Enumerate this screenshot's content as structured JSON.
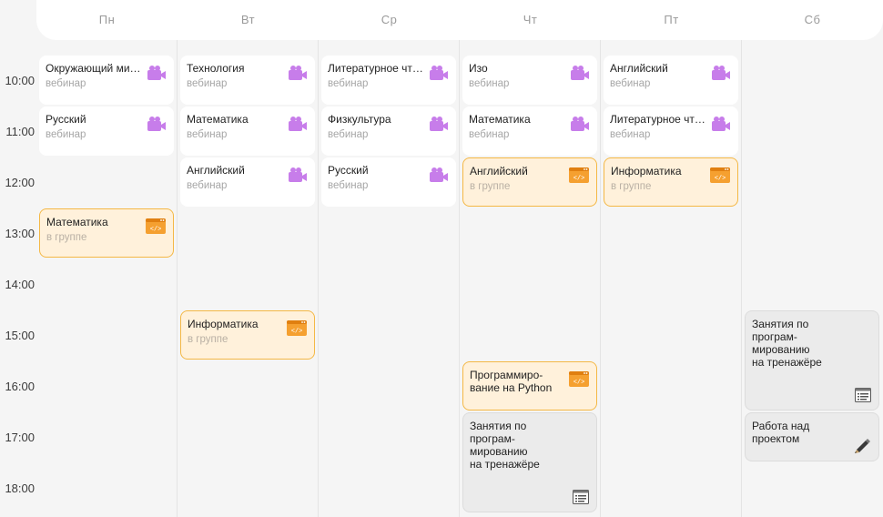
{
  "days": [
    "Пн",
    "Вт",
    "Ср",
    "Чт",
    "Пт",
    "Сб"
  ],
  "times": [
    "10:00",
    "11:00",
    "12:00",
    "13:00",
    "14:00",
    "15:00",
    "16:00",
    "17:00",
    "18:00"
  ],
  "lessons": [
    {
      "day": 0,
      "start": "10:00",
      "end": "11:00",
      "title": "Окружающий ми…",
      "subtitle": "вебинар",
      "kind": "webinar",
      "icon": "video-camera-icon"
    },
    {
      "day": 0,
      "start": "11:00",
      "end": "12:00",
      "title": "Русский",
      "subtitle": "вебинар",
      "kind": "webinar",
      "icon": "video-camera-icon"
    },
    {
      "day": 0,
      "start": "13:00",
      "end": "14:00",
      "title": "Математика",
      "subtitle": "в группе",
      "kind": "group",
      "icon": "code-window-icon"
    },
    {
      "day": 1,
      "start": "10:00",
      "end": "11:00",
      "title": "Технология",
      "subtitle": "вебинар",
      "kind": "webinar",
      "icon": "video-camera-icon"
    },
    {
      "day": 1,
      "start": "11:00",
      "end": "12:00",
      "title": "Математика",
      "subtitle": "вебинар",
      "kind": "webinar",
      "icon": "video-camera-icon"
    },
    {
      "day": 1,
      "start": "12:00",
      "end": "13:00",
      "title": "Английский",
      "subtitle": "вебинар",
      "kind": "webinar",
      "icon": "video-camera-icon"
    },
    {
      "day": 1,
      "start": "15:00",
      "end": "16:00",
      "title": "Информатика",
      "subtitle": "в группе",
      "kind": "group",
      "icon": "code-window-icon"
    },
    {
      "day": 2,
      "start": "10:00",
      "end": "11:00",
      "title": "Литературное чт…",
      "subtitle": "вебинар",
      "kind": "webinar",
      "icon": "video-camera-icon"
    },
    {
      "day": 2,
      "start": "11:00",
      "end": "12:00",
      "title": "Физкультура",
      "subtitle": "вебинар",
      "kind": "webinar",
      "icon": "video-camera-icon"
    },
    {
      "day": 2,
      "start": "12:00",
      "end": "13:00",
      "title": "Русский",
      "subtitle": "вебинар",
      "kind": "webinar",
      "icon": "video-camera-icon"
    },
    {
      "day": 3,
      "start": "10:00",
      "end": "11:00",
      "title": "Изо",
      "subtitle": "вебинар",
      "kind": "webinar",
      "icon": "video-camera-icon"
    },
    {
      "day": 3,
      "start": "11:00",
      "end": "12:00",
      "title": "Математика",
      "subtitle": "вебинар",
      "kind": "webinar",
      "icon": "video-camera-icon"
    },
    {
      "day": 3,
      "start": "12:00",
      "end": "13:00",
      "title": "Английский",
      "subtitle": "в группе",
      "kind": "group",
      "icon": "code-window-icon"
    },
    {
      "day": 3,
      "start": "16:00",
      "end": "17:00",
      "title": "Программиро-\nвание на Python",
      "subtitle": "",
      "kind": "group",
      "icon": "code-window-icon"
    },
    {
      "day": 3,
      "start": "17:00",
      "end": "19:00",
      "title": "Занятия по програм-\nмированию\nна тренажёре",
      "subtitle": "",
      "kind": "trainer",
      "icon": "list-icon"
    },
    {
      "day": 4,
      "start": "10:00",
      "end": "11:00",
      "title": "Английский",
      "subtitle": "вебинар",
      "kind": "webinar",
      "icon": "video-camera-icon"
    },
    {
      "day": 4,
      "start": "11:00",
      "end": "12:00",
      "title": "Литературное чт…",
      "subtitle": "вебинар",
      "kind": "webinar",
      "icon": "video-camera-icon"
    },
    {
      "day": 4,
      "start": "12:00",
      "end": "13:00",
      "title": "Информатика",
      "subtitle": "в группе",
      "kind": "group",
      "icon": "code-window-icon"
    },
    {
      "day": 5,
      "start": "15:00",
      "end": "17:00",
      "title": "Занятия по програм-\nмированию\nна тренажёре",
      "subtitle": "",
      "kind": "trainer",
      "icon": "list-icon"
    },
    {
      "day": 5,
      "start": "17:00",
      "end": "18:00",
      "title": "Работа над проектом",
      "subtitle": "",
      "kind": "trainer",
      "icon": "pencil-icon"
    }
  ],
  "colors": {
    "webinar_bg": "#ffffff",
    "group_bg": "#fff1db",
    "group_border": "#f4b845",
    "trainer_bg": "#ebebeb",
    "camera_icon": "#c77dea",
    "code_icon": "#f5a030"
  }
}
